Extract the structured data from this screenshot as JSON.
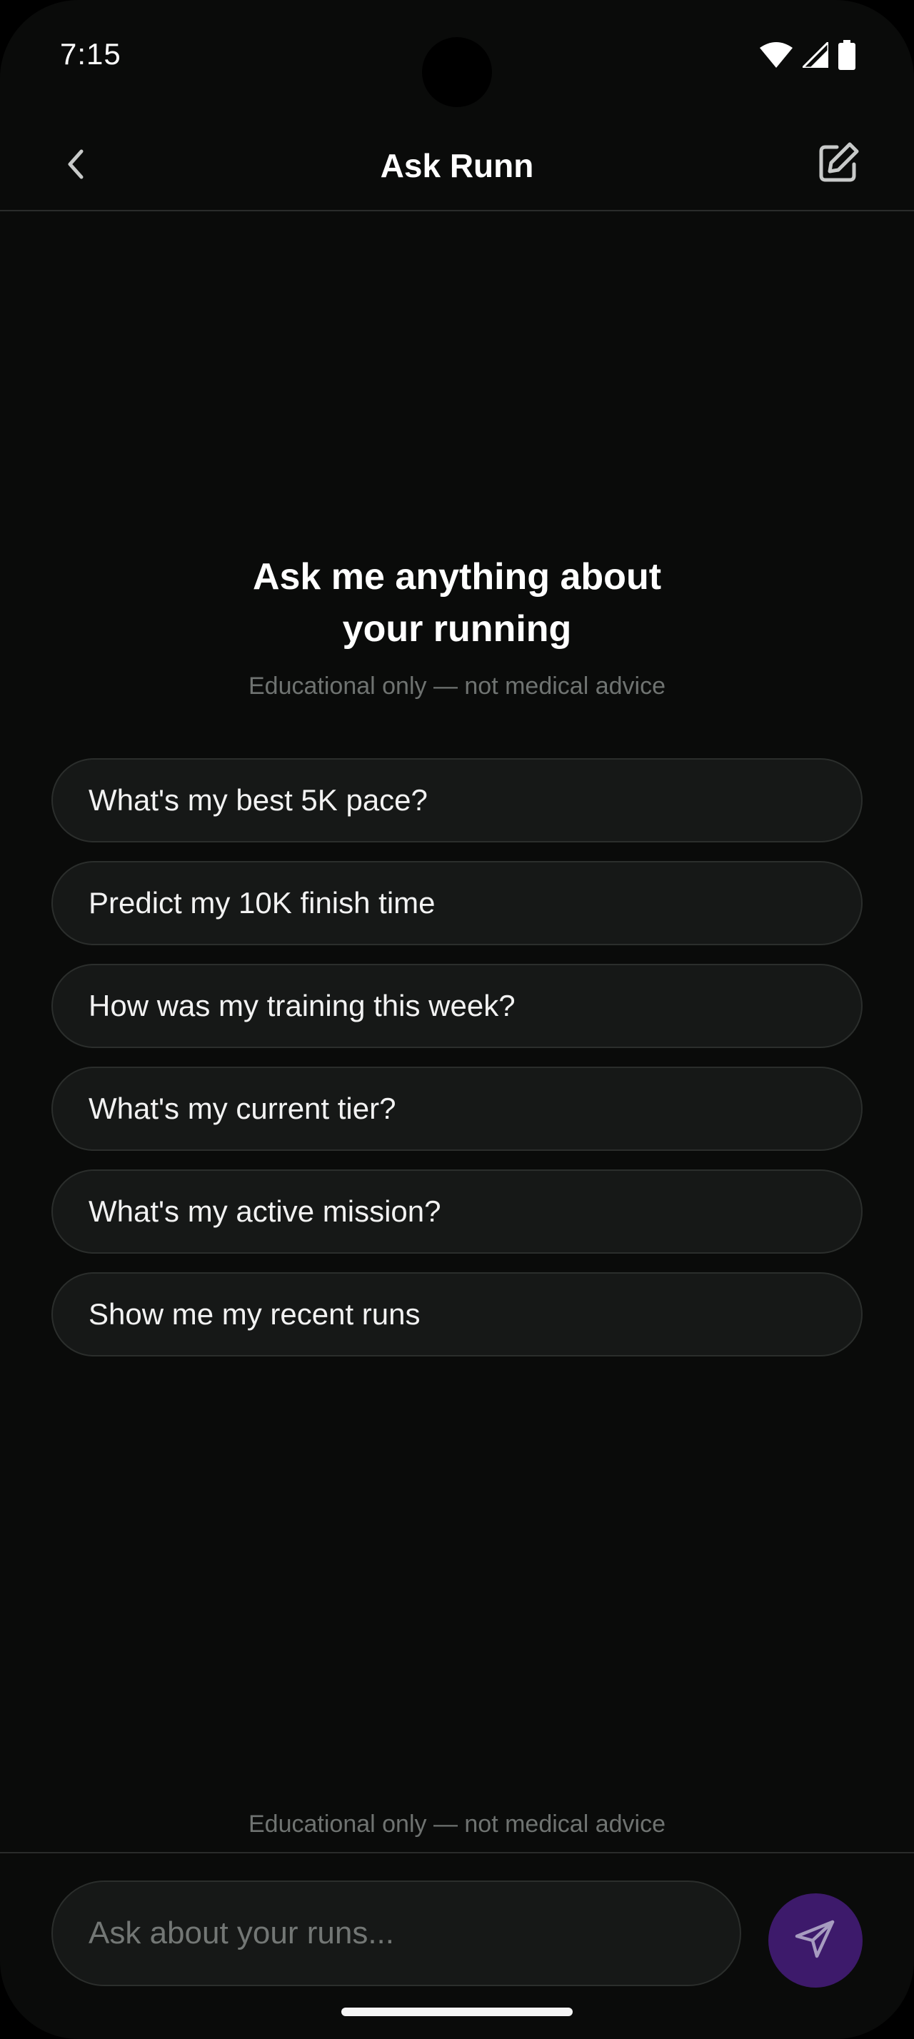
{
  "status_bar": {
    "time": "7:15"
  },
  "header": {
    "title": "Ask Runn",
    "back_icon": "chevron-left-icon",
    "edit_icon": "edit-square-icon"
  },
  "hero": {
    "title_line1": "Ask me anything about",
    "title_line2": "your running",
    "subtitle": "Educational only — not medical advice"
  },
  "suggestions": [
    "What's my best 5K pace?",
    "Predict my 10K finish time",
    "How was my training this week?",
    "What's my current tier?",
    "What's my active mission?",
    "Show me my recent runs"
  ],
  "footer": {
    "note": "Educational only — not medical advice"
  },
  "composer": {
    "placeholder": "Ask about your runs...",
    "value": "",
    "send_icon": "send-icon"
  },
  "colors": {
    "background": "#0a0b0a",
    "chip_background": "#161817",
    "muted_text": "#6f7371",
    "send_button": "#3d1a6b"
  }
}
